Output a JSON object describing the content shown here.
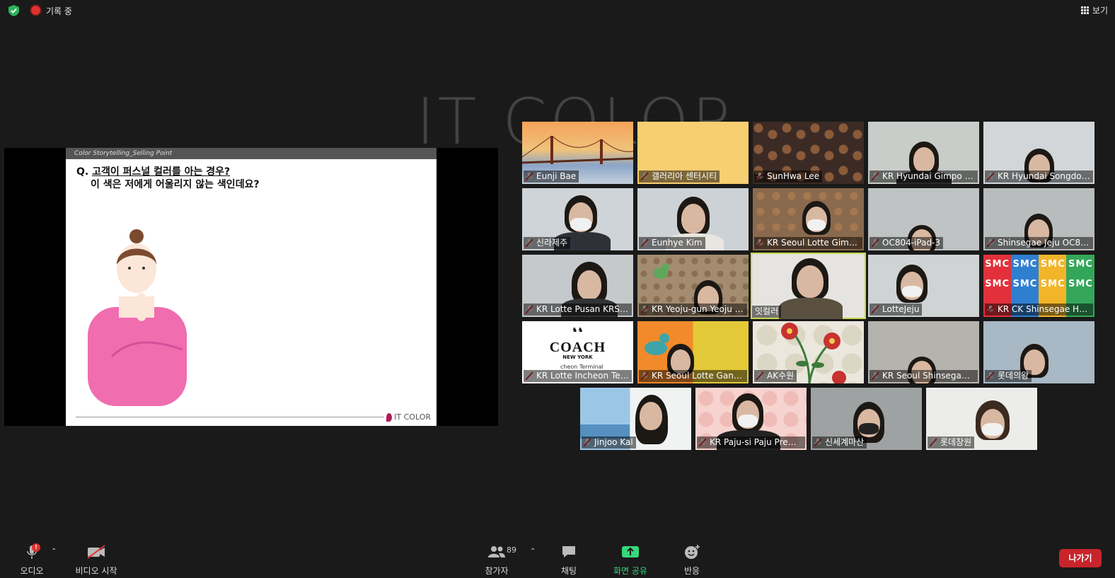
{
  "topbar": {
    "recording_label": "기록 중",
    "view_label": "보기"
  },
  "slide": {
    "header": "Color Storytelling_Selling Point",
    "q_prefix": "Q. ",
    "q_line1_underlined": "고객이 퍼스널 컬러를 아는 경우?",
    "q_line2": "이 색은 저에게 어울리지 않는 색인데요?",
    "logo_text": "IT COLOR"
  },
  "watermark": "IT COLOR",
  "participants": [
    {
      "name": "Eunji Bae"
    },
    {
      "name": "갤러리아 센터시티"
    },
    {
      "name": "SunHwa Lee"
    },
    {
      "name": "KR Hyundai Gimpo O..."
    },
    {
      "name": "KR Hyundai Songdo ..."
    },
    {
      "name": "신라제주"
    },
    {
      "name": "Eunhye Kim"
    },
    {
      "name": "KR Seoul Lotte Gimp..."
    },
    {
      "name": "OC804-iPad-3"
    },
    {
      "name": "Shinsegae Jeju OC864"
    },
    {
      "name": "KR Lotte Pusan KRS011"
    },
    {
      "name": "KR Yeoju-gun Yeoju P..."
    },
    {
      "name": "잇컬러"
    },
    {
      "name": "LotteJeju"
    },
    {
      "name": "KR CK Shinsegae Han..."
    },
    {
      "name": "KR Lotte Incheon Ter..."
    },
    {
      "name": "KR Seoul Lotte Gang..."
    },
    {
      "name": "AK수원"
    },
    {
      "name": "KR Seoul Shinsegae ..."
    },
    {
      "name": "롯데의왕"
    },
    {
      "name": "Jinjoo Kal"
    },
    {
      "name": "KR Paju-si Paju Premi..."
    },
    {
      "name": "신세계마산"
    },
    {
      "name": "롯데창원"
    }
  ],
  "coach_logo": {
    "brand": "COACH",
    "sub": "NEW YORK",
    "caption": "cheon Terminal"
  },
  "smc_text": "SMC",
  "toolbar": {
    "audio": "오디오",
    "audio_badge": "!",
    "video": "비디오 시작",
    "participants": "참가자",
    "participants_count": "89",
    "chat": "채팅",
    "share": "화면 공유",
    "reactions": "반응",
    "leave": "나가기"
  },
  "colors": {
    "background": "#1a1a1a",
    "active_speaker": "#c7d94b",
    "share_green": "#37d67a",
    "leave_red": "#c8242b",
    "record_red": "#e0312f"
  }
}
